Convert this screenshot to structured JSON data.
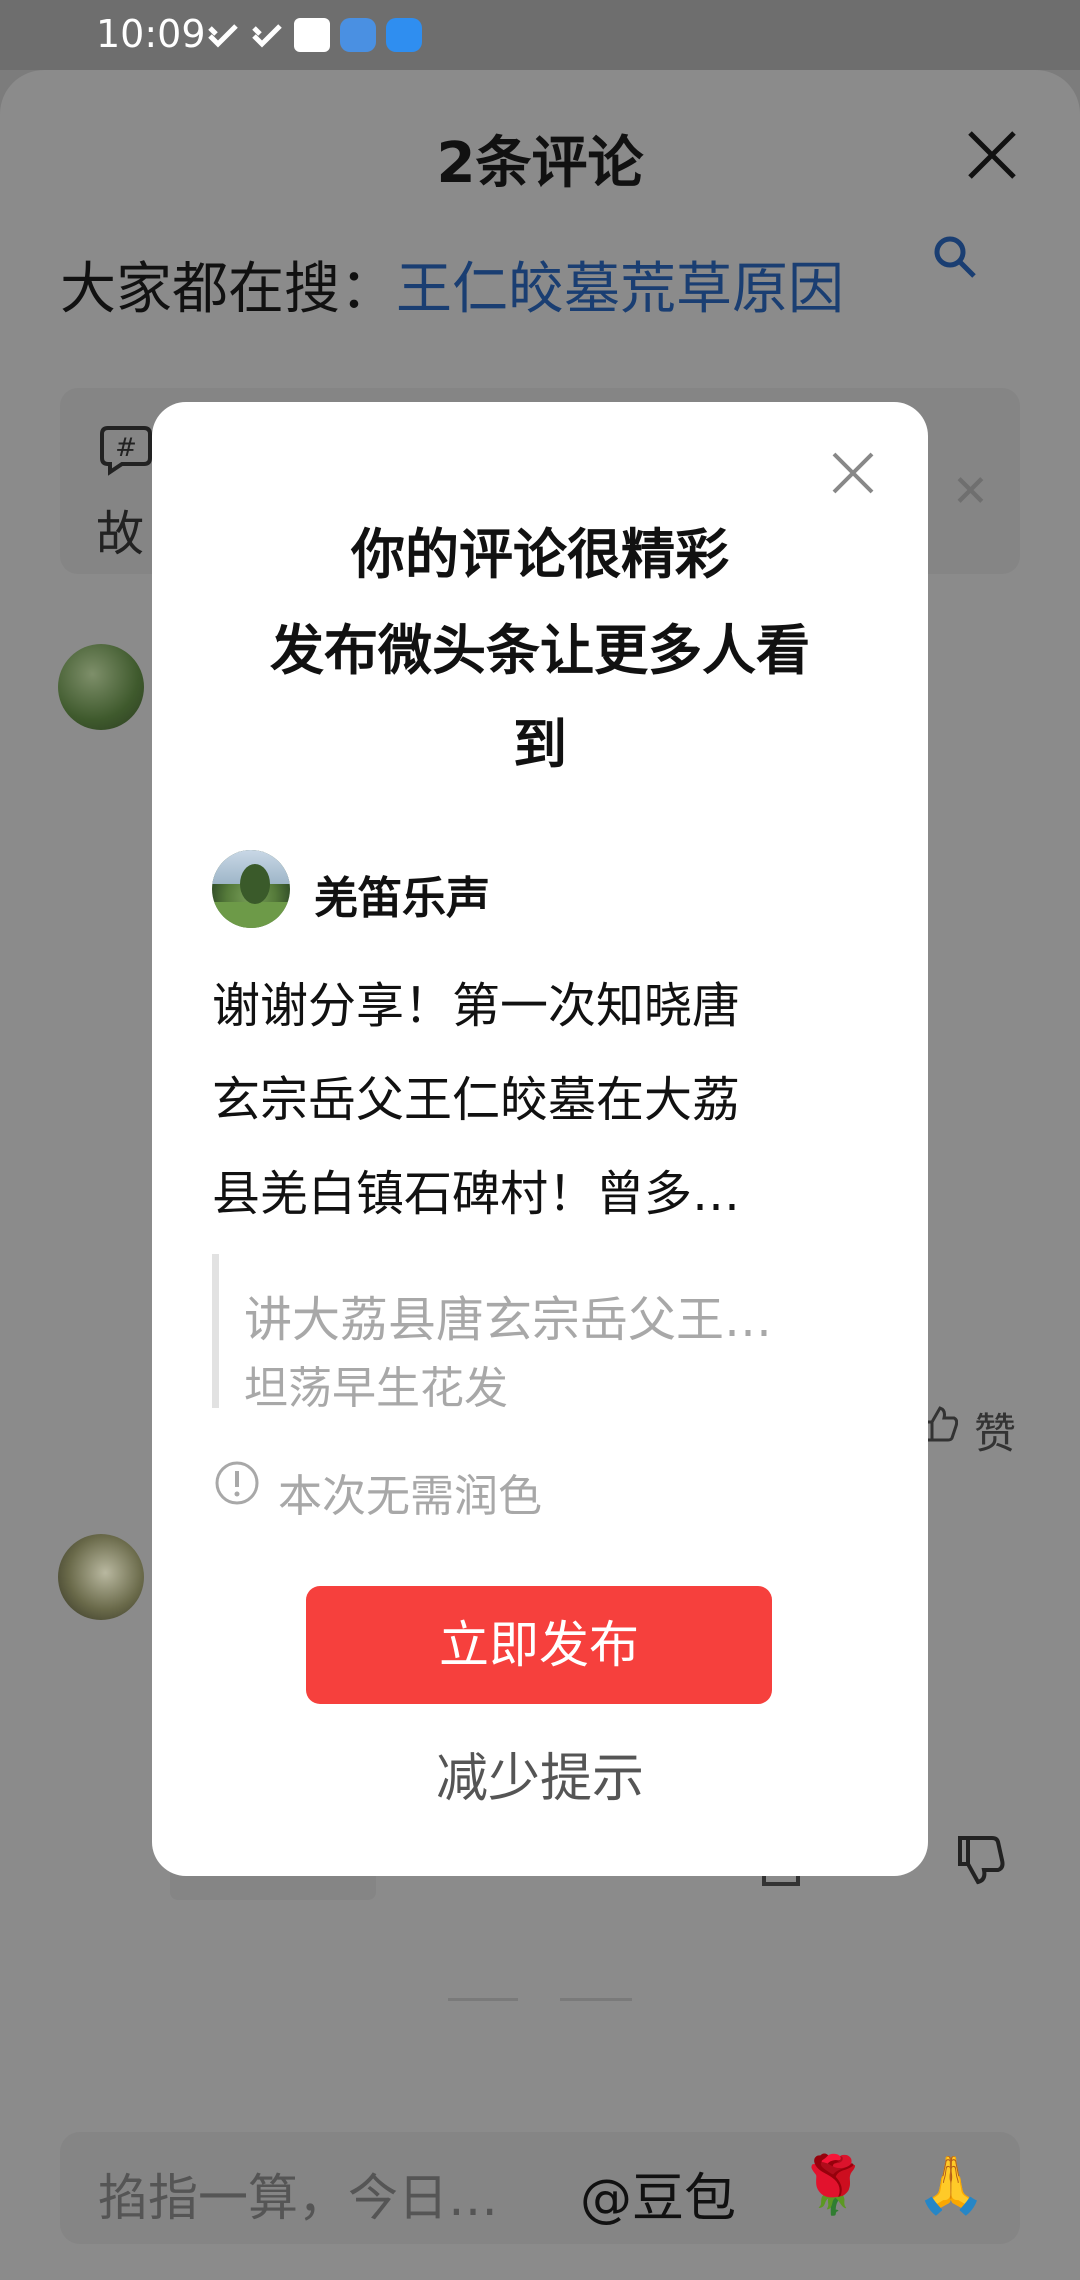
{
  "status_bar": {
    "time": "10:09"
  },
  "sheet": {
    "title": "2条评论",
    "search_hint": {
      "prefix": "大家都在搜：",
      "keyword": "王仁皎墓荒草原因"
    },
    "topic_partial": "故",
    "like_label": "赞"
  },
  "modal": {
    "title_line1": "你的评论很精彩",
    "title_line2": "发布微头条让更多人看",
    "title_line3": "到",
    "username": "羌笛乐声",
    "comment_lines": [
      "谢谢分享！第一次知晓唐",
      "玄宗岳父王仁皎墓在大荔",
      "县羌白镇石碑村！曾多…"
    ],
    "quote_title": "讲大荔县唐玄宗岳父王…",
    "quote_author": "坦荡早生花发",
    "info_text": "本次无需润色",
    "publish_label": "立即发布",
    "reduce_label": "减少提示"
  },
  "input_bar": {
    "placeholder": "掐指一算，今日…",
    "doubao": "@豆包",
    "emoji_rose": "🌹",
    "emoji_pray": "🙏"
  }
}
